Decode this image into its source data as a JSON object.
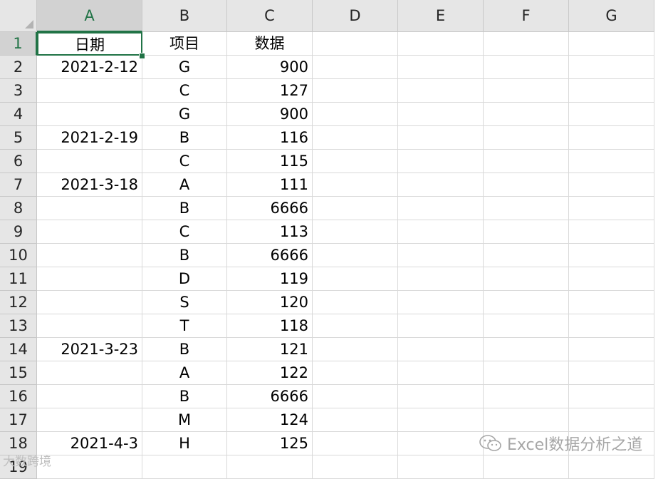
{
  "columns": [
    "A",
    "B",
    "C",
    "D",
    "E",
    "F",
    "G"
  ],
  "rows": [
    "1",
    "2",
    "3",
    "4",
    "5",
    "6",
    "7",
    "8",
    "9",
    "10",
    "11",
    "12",
    "13",
    "14",
    "15",
    "16",
    "17",
    "18",
    "19"
  ],
  "cells": [
    [
      "日期",
      "项目",
      "数据"
    ],
    [
      "2021-2-12",
      "G",
      "900"
    ],
    [
      "",
      "C",
      "127"
    ],
    [
      "",
      "G",
      "900"
    ],
    [
      "2021-2-19",
      "B",
      "116"
    ],
    [
      "",
      "C",
      "115"
    ],
    [
      "2021-3-18",
      "A",
      "111"
    ],
    [
      "",
      "B",
      "6666"
    ],
    [
      "",
      "C",
      "113"
    ],
    [
      "",
      "B",
      "6666"
    ],
    [
      "",
      "D",
      "119"
    ],
    [
      "",
      "S",
      "120"
    ],
    [
      "",
      "T",
      "118"
    ],
    [
      "2021-3-23",
      "B",
      "121"
    ],
    [
      "",
      "A",
      "122"
    ],
    [
      "",
      "B",
      "6666"
    ],
    [
      "",
      "M",
      "124"
    ],
    [
      "2021-4-3",
      "H",
      "125"
    ],
    [
      "",
      "",
      ""
    ]
  ],
  "selected_cell": "A1",
  "watermark_right": "Excel数据分析之道",
  "watermark_left": "大数跨境",
  "colors": {
    "accent": "#217346",
    "header_bg": "#e6e6e6",
    "grid": "#d9d9d9"
  }
}
